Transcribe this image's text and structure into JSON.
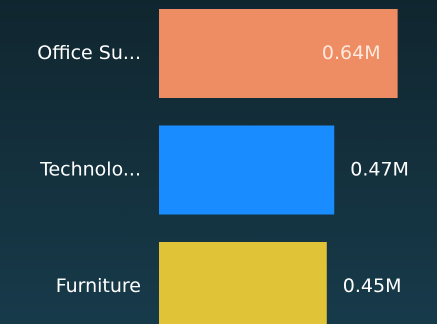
{
  "chart_data": {
    "type": "bar",
    "orientation": "horizontal",
    "categories": [
      "Office Su...",
      "Technolo...",
      "Furniture"
    ],
    "values": [
      0.64,
      0.47,
      0.45
    ],
    "value_labels": [
      "0.64M",
      "0.47M",
      "0.45M"
    ],
    "colors": [
      "#ee8c63",
      "#198cff",
      "#e1c338"
    ],
    "label_inside_color": "#ffe8dc",
    "label_outside_color": "#ffffff",
    "xlim": [
      0,
      0.7
    ]
  }
}
